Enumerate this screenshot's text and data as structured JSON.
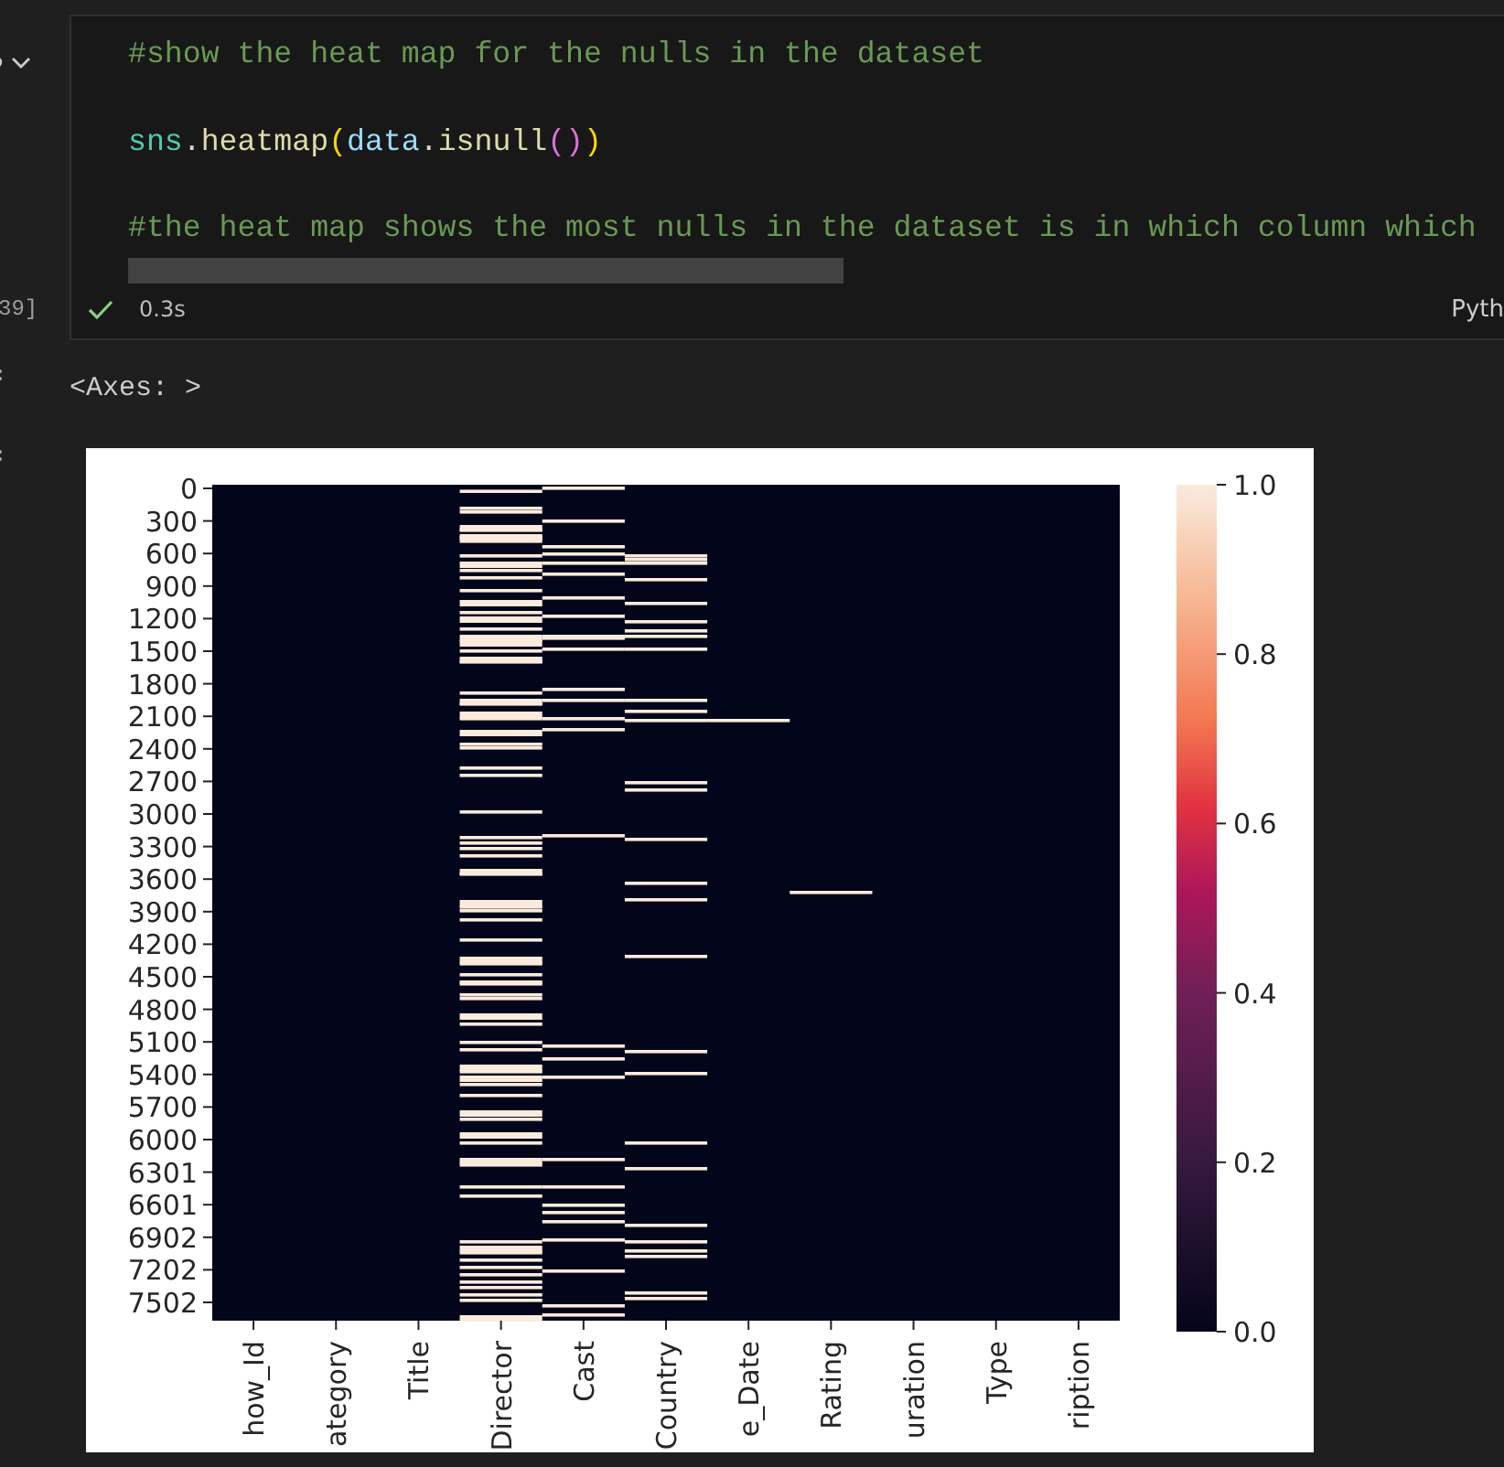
{
  "gutter": {
    "execution_count": "39]"
  },
  "cell": {
    "lines": [
      [
        {
          "kind": "comment",
          "text": "#show the heat map for the nulls in the dataset"
        }
      ],
      [
        {
          "kind": "module",
          "text": "sns"
        },
        {
          "kind": "punct",
          "text": "."
        },
        {
          "kind": "func",
          "text": "heatmap"
        },
        {
          "kind": "bracket1",
          "text": "("
        },
        {
          "kind": "var",
          "text": "data"
        },
        {
          "kind": "punct",
          "text": "."
        },
        {
          "kind": "func",
          "text": "isnull"
        },
        {
          "kind": "bracket2",
          "text": "()"
        },
        {
          "kind": "bracket1",
          "text": ")"
        }
      ],
      [
        {
          "kind": "comment",
          "text": "#the heat map shows the most nulls in the dataset is in which column which"
        }
      ]
    ]
  },
  "status": {
    "succeeded": true,
    "duration": "0.3s",
    "language": "Pyth"
  },
  "output": {
    "text": "<Axes: >",
    "plot": {
      "y_ticks": [
        "0",
        "300",
        "600",
        "900",
        "1200",
        "1500",
        "1800",
        "2100",
        "2400",
        "2700",
        "3000",
        "3300",
        "3600",
        "3900",
        "4200",
        "4500",
        "4800",
        "5100",
        "5400",
        "5700",
        "6000",
        "6301",
        "6601",
        "6902",
        "7202",
        "7502"
      ],
      "x_labels": [
        "how_Id",
        "ategory",
        "Title",
        "Director",
        "Cast",
        "Country",
        "e_Date",
        "Rating",
        "uration",
        "Type",
        "ription"
      ],
      "colorbar_ticks": [
        "1.0",
        "0.8",
        "0.6",
        "0.4",
        "0.2",
        "0.0"
      ]
    }
  }
}
